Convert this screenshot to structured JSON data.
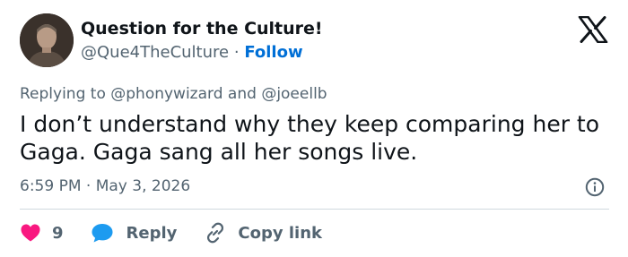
{
  "author": {
    "display_name": "Question for the Culture!",
    "handle": "@Que4TheCulture",
    "separator": "·",
    "follow_label": "Follow"
  },
  "reply_context": {
    "prefix": "Replying to",
    "mention_1": "@phonywizard",
    "conjunction": "and",
    "mention_2": "@joeellb"
  },
  "tweet": {
    "text": "I don’t understand why they keep comparing her to Gaga. Gaga sang all her songs live.",
    "timestamp": "6:59 PM · May 3, 2026"
  },
  "actions": {
    "like_count": "9",
    "reply_label": "Reply",
    "copy_link_label": "Copy link"
  },
  "icons": {
    "brand": "x-logo-icon",
    "info": "info-icon",
    "like": "heart-icon",
    "reply": "speech-bubble-icon",
    "copy": "link-icon"
  },
  "colors": {
    "accent": "#006fd6",
    "like": "#f91880",
    "reply": "#1d9bf0",
    "muted": "#536471",
    "text": "#0f1419"
  }
}
